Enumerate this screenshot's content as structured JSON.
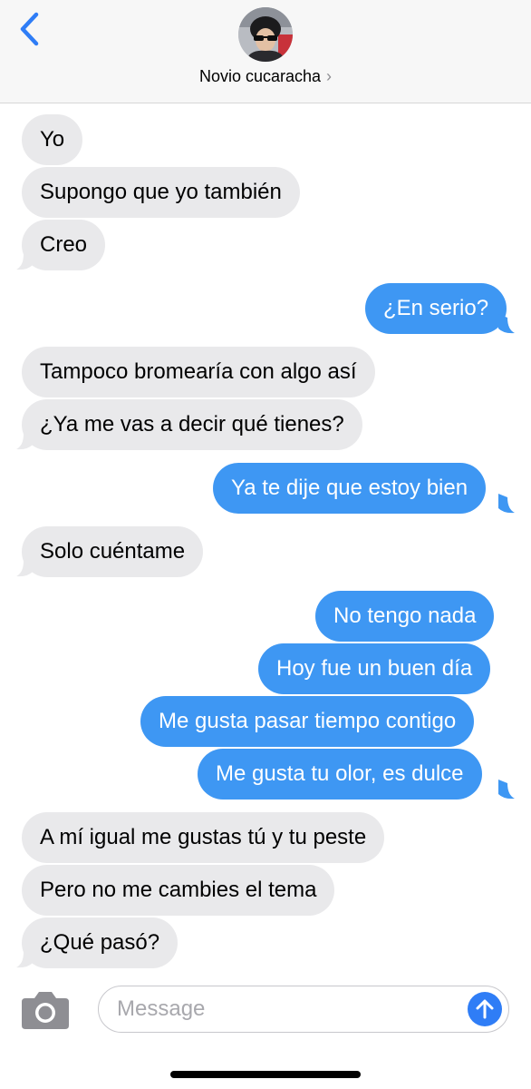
{
  "header": {
    "contact_name": "Novio cucaracha",
    "chevron": "›",
    "back_icon": "chevron-left-icon",
    "avatar": "contact-avatar"
  },
  "colors": {
    "incoming_bubble": "#e9e9eb",
    "outgoing_bubble": "#3e97f3",
    "accent": "#2f7df6",
    "back_arrow": "#2f7df6"
  },
  "messages": [
    {
      "from": "them",
      "text": "Yo"
    },
    {
      "from": "them",
      "text": "Supongo que yo también"
    },
    {
      "from": "them",
      "text": "Creo"
    },
    {
      "from": "me",
      "text": "¿En serio?"
    },
    {
      "from": "them",
      "text": "Tampoco bromearía con algo así"
    },
    {
      "from": "them",
      "text": "¿Ya me vas a decir qué tienes?"
    },
    {
      "from": "me",
      "text": "Ya te dije que estoy bien"
    },
    {
      "from": "them",
      "text": "Solo cuéntame"
    },
    {
      "from": "me",
      "text": "No tengo nada"
    },
    {
      "from": "me",
      "text": "Hoy fue un buen día"
    },
    {
      "from": "me",
      "text": "Me gusta pasar tiempo contigo"
    },
    {
      "from": "me",
      "text": "Me gusta tu olor, es dulce"
    },
    {
      "from": "them",
      "text": "A mí igual me gustas tú y tu peste"
    },
    {
      "from": "them",
      "text": "Pero no me cambies el tema"
    },
    {
      "from": "them",
      "text": "¿Qué pasó?"
    }
  ],
  "composer": {
    "placeholder": "Message",
    "camera_icon": "camera-icon",
    "send_icon": "send-arrow-icon"
  }
}
